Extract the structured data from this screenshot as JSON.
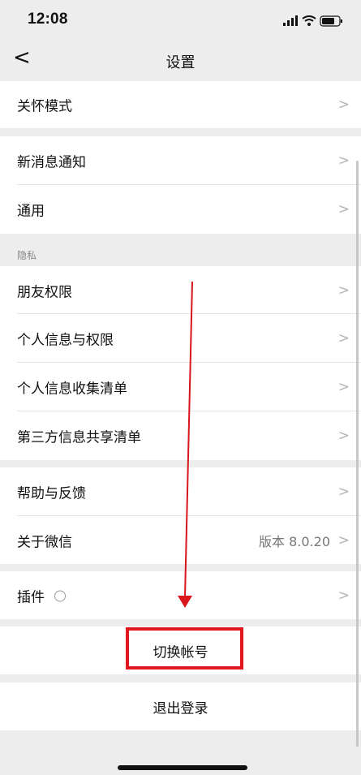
{
  "status": {
    "time": "12:08"
  },
  "nav": {
    "title": "设置",
    "back": "<"
  },
  "rows": {
    "care_mode": "关怀模式",
    "new_msg": "新消息通知",
    "general": "通用",
    "privacy_section": "隐私",
    "friend_perm": "朋友权限",
    "personal_info_perm": "个人信息与权限",
    "personal_info_list": "个人信息收集清单",
    "third_party_list": "第三方信息共享清单",
    "help_feedback": "帮助与反馈",
    "about": "关于微信",
    "about_version": "版本 8.0.20",
    "plugins": "插件"
  },
  "actions": {
    "switch_account": "切换帐号",
    "logout": "退出登录"
  },
  "chevron": ">",
  "colors": {
    "highlight": "#e3161d",
    "annotation_arrow": "#d8161c"
  },
  "icons": [
    "back-icon",
    "chevron-right-icon",
    "plugin-icon",
    "signal-icon",
    "wifi-icon",
    "battery-icon"
  ]
}
